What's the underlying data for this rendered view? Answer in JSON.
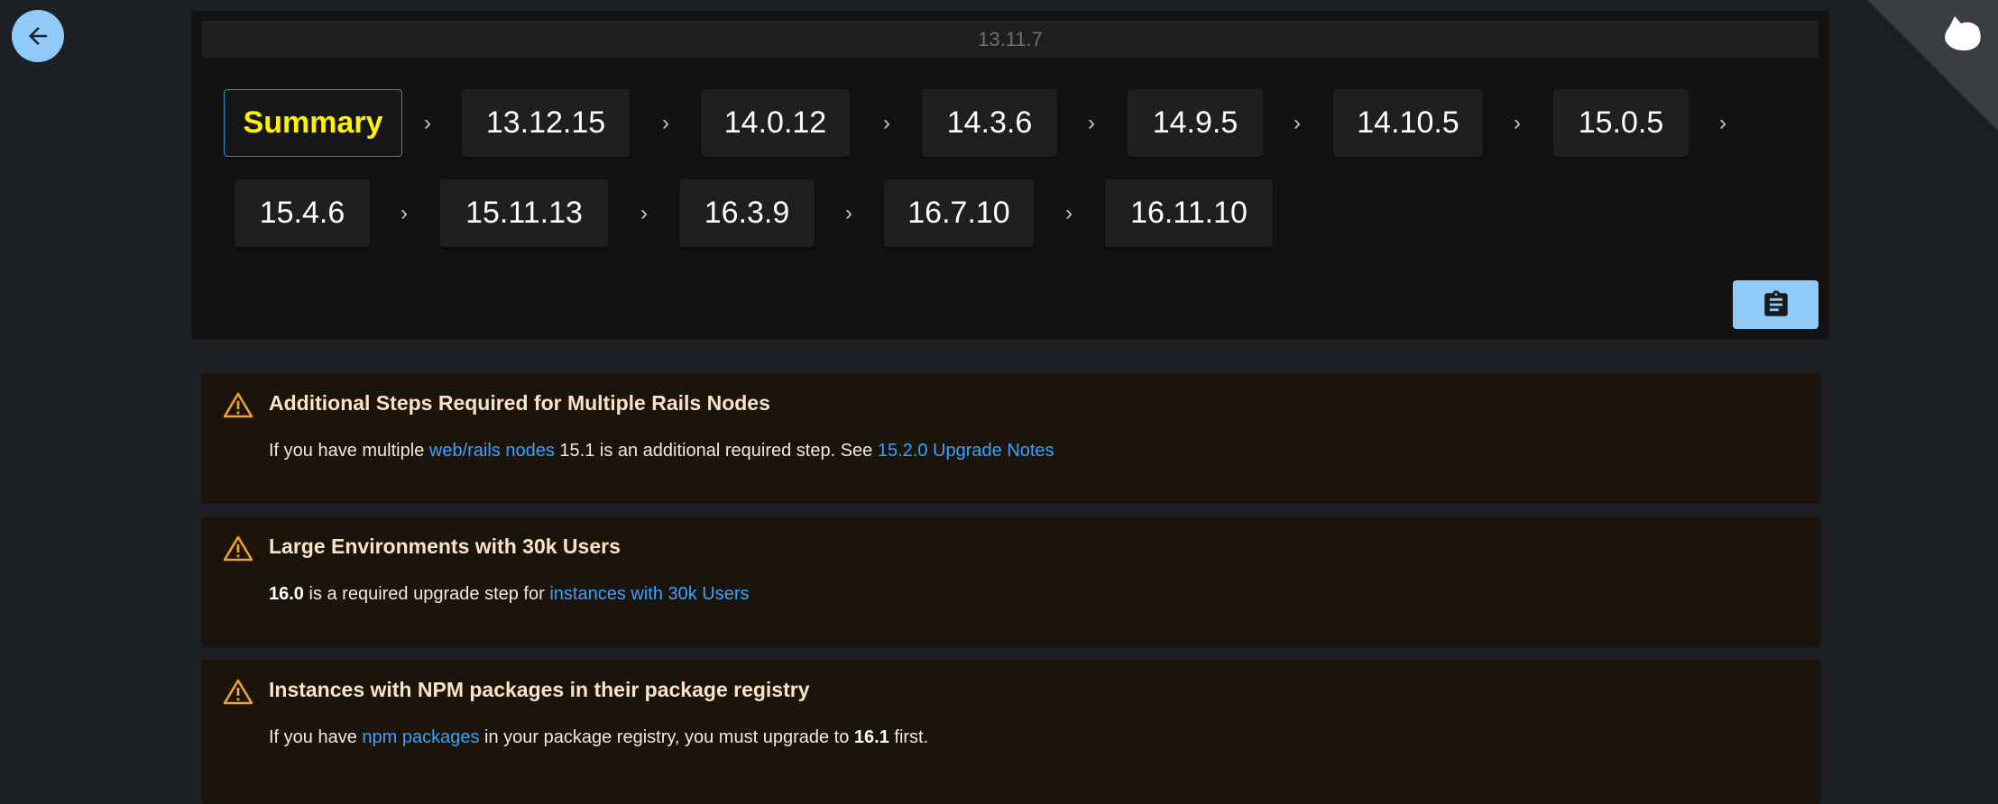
{
  "nav": {
    "back_icon": "arrow-left-icon",
    "logo_icon": "app-logo-icon"
  },
  "path": {
    "current_version": "13.11.7",
    "steps": [
      "Summary",
      "13.12.15",
      "14.0.12",
      "14.3.6",
      "14.9.5",
      "14.10.5",
      "15.0.5",
      "15.4.6",
      "15.11.13",
      "16.3.9",
      "16.7.10",
      "16.11.10"
    ],
    "active_step": "Summary",
    "copy_icon": "clipboard-icon"
  },
  "colors": {
    "accent": "#90caf9",
    "active": "#fff200",
    "link": "#3ea0ff",
    "warning": "#f0a030",
    "alert_bg": "#1b140b"
  },
  "alerts": [
    {
      "title": "Additional Steps Required for Multiple Rails Nodes",
      "body_parts": [
        "If you have multiple ",
        "web/rails nodes",
        " 15.1 is an additional required step. See ",
        "15.2.0 Upgrade Notes"
      ]
    },
    {
      "title": "Large Environments with 30k Users",
      "body_parts": [
        "16.0",
        " is a required upgrade step for ",
        "instances with 30k Users"
      ]
    },
    {
      "title": "Instances with NPM packages in their package registry",
      "body_parts": [
        "If you have ",
        "npm packages",
        " in your package registry, you must upgrade to ",
        "16.1",
        " first."
      ]
    }
  ]
}
